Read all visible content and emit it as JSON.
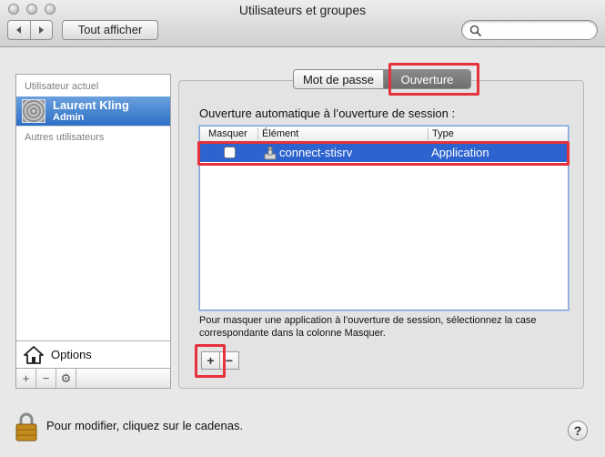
{
  "window": {
    "title": "Utilisateurs et groupes"
  },
  "toolbar": {
    "back_icon": "chevron-left-icon",
    "forward_icon": "chevron-right-icon",
    "show_all_label": "Tout afficher",
    "search_placeholder": "",
    "search_value": ""
  },
  "sidebar": {
    "current_user_label": "Utilisateur actuel",
    "current_user": {
      "name": "Laurent Kling",
      "role": "Admin"
    },
    "other_users_label": "Autres utilisateurs",
    "options_label": "Options",
    "footer_buttons": [
      "+",
      "−",
      "⚙"
    ]
  },
  "tabs": {
    "password_label": "Mot de passe",
    "login_label": "Ouverture",
    "selected": "Ouverture"
  },
  "login_items": {
    "heading": "Ouverture automatique à l’ouverture de session :",
    "columns": [
      "Masquer",
      "Élément",
      "Type"
    ],
    "rows": [
      {
        "hide": false,
        "item": "connect-stisrv",
        "type": "Application",
        "selected": true
      }
    ],
    "hint": "Pour masquer une application à l’ouverture de session, sélectionnez la case correspondante dans la colonne Masquer.",
    "add_label": "+",
    "remove_label": "−"
  },
  "footer": {
    "lock_label": "Pour modifier, cliquez sur le cadenas.",
    "help_label": "?"
  },
  "colors": {
    "selection": "#2d63cf",
    "highlight_box": "#e5323c"
  }
}
